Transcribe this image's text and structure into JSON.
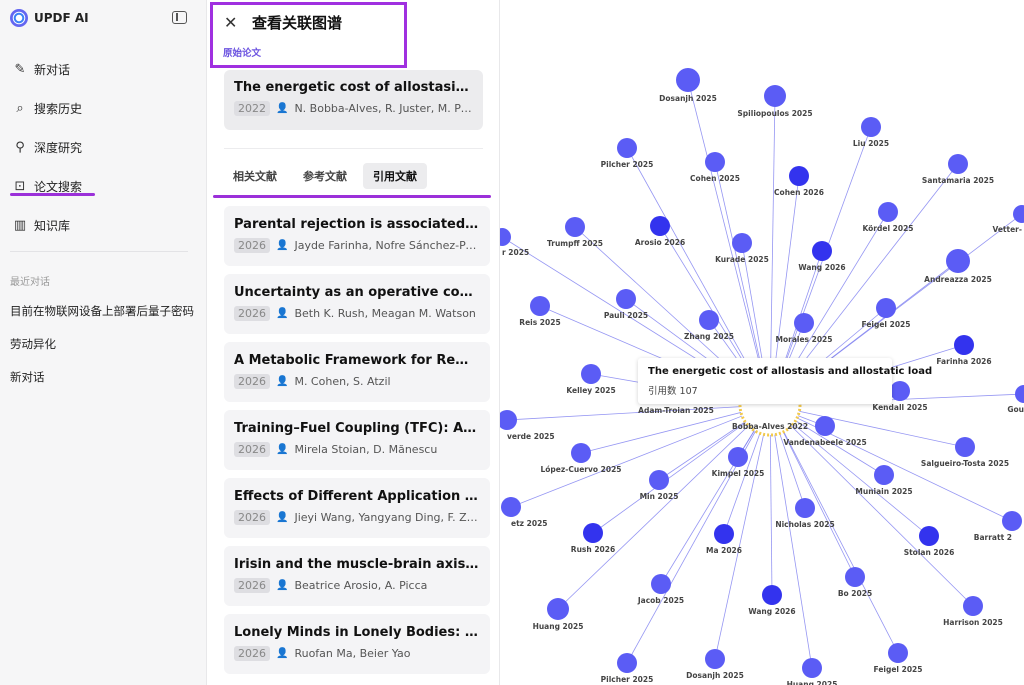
{
  "sidebar": {
    "brand": "UPDF AI",
    "nav": [
      {
        "label": "新对话",
        "icon": "edit-icon"
      },
      {
        "label": "搜索历史",
        "icon": "search-icon"
      },
      {
        "label": "深度研究",
        "icon": "telescope-icon"
      },
      {
        "label": "论文搜索",
        "icon": "paper-search-icon"
      },
      {
        "label": "知识库",
        "icon": "book-icon"
      }
    ],
    "recent_title": "最近对话",
    "recent": [
      "目前在物联网设备上部署后量子密码",
      "劳动异化",
      "新对话"
    ]
  },
  "panel": {
    "title": "查看关联图谱",
    "source_label": "原始论文",
    "source_paper": {
      "title": "The energetic cost of allostasis and allostatic load",
      "year": "2022",
      "authors": "N. Bobba-Alves, R. Juster, M. Picard"
    },
    "tabs": [
      "相关文献",
      "参考文献",
      "引用文献"
    ],
    "active_tab": "引用文献",
    "papers": [
      {
        "title": "Parental rejection is associated with",
        "year": "2026",
        "authors": "Jayde Farinha, Nofre Sánchez-Perea"
      },
      {
        "title": "Uncertainty as an operative construct",
        "year": "2026",
        "authors": "Beth K. Rush, Meagan M. Watson"
      },
      {
        "title": "A Metabolic Framework for Reward",
        "year": "2026",
        "authors": "M. Cohen, S. Atzil"
      },
      {
        "title": "Training–Fuel Coupling (TFC): A Model",
        "year": "2026",
        "authors": "Mirela Stoian, D. Mănescu"
      },
      {
        "title": "Effects of Different Application Strategies",
        "year": "2026",
        "authors": "Jieyi Wang, Yangyang Ding, F. Zhang"
      },
      {
        "title": "Irisin and the muscle-brain axis: a review",
        "year": "2026",
        "authors": "Beatrice Arosio, A. Picca"
      },
      {
        "title": "Lonely Minds in Lonely Bodies: Loneliness",
        "year": "2026",
        "authors": "Ruofan Ma, Beier Yao"
      }
    ]
  },
  "graph": {
    "tooltip_title": "The energetic cost of allostasis and allostatic load",
    "tooltip_count": "引用数 107",
    "center_label": "Bobba-Alves 2022",
    "colors": {
      "node": "#5b5cf5",
      "node_dark": "#3333ee",
      "edge": "#7b7cf0",
      "center": "#f2c94c"
    },
    "nodes": [
      {
        "label": "Dosanjh 2025",
        "dark": false
      },
      {
        "label": "Spiliopoulos 2025",
        "dark": false
      },
      {
        "label": "Liu 2025",
        "dark": false
      },
      {
        "label": "Pilcher 2025",
        "dark": false
      },
      {
        "label": "Cohen 2025",
        "dark": false
      },
      {
        "label": "Cohen 2026",
        "dark": true
      },
      {
        "label": "Santamaria 2025",
        "dark": false
      },
      {
        "label": "Vetter-",
        "dark": false
      },
      {
        "label": "Trumpff 2025",
        "dark": false
      },
      {
        "label": "Arosio 2026",
        "dark": true
      },
      {
        "label": "Kurade 2025",
        "dark": false
      },
      {
        "label": "Kördel 2025",
        "dark": false
      },
      {
        "label": "r 2025",
        "dark": false
      },
      {
        "label": "Wang 2026",
        "dark": true
      },
      {
        "label": "Andreazza 2025",
        "dark": false
      },
      {
        "label": "Reis 2025",
        "dark": false
      },
      {
        "label": "Pauli 2025",
        "dark": false
      },
      {
        "label": "Zhang 2025",
        "dark": false
      },
      {
        "label": "Feigel 2025",
        "dark": false
      },
      {
        "label": "Morales 2025",
        "dark": false
      },
      {
        "label": "Farinha 2026",
        "dark": true
      },
      {
        "label": "Kelley 2025",
        "dark": false
      },
      {
        "label": "Kendall 2025",
        "dark": false
      },
      {
        "label": "Adam-Troian 2025",
        "dark": false
      },
      {
        "label": "Gou",
        "dark": false
      },
      {
        "label": "verde 2025",
        "dark": false
      },
      {
        "label": "Vandenabeele 2025",
        "dark": false
      },
      {
        "label": "Salgueiro-Tosta 2025",
        "dark": false
      },
      {
        "label": "López-Cuervo 2025",
        "dark": false
      },
      {
        "label": "Kimpel 2025",
        "dark": false
      },
      {
        "label": "Muniain 2025",
        "dark": false
      },
      {
        "label": "Min 2025",
        "dark": false
      },
      {
        "label": "etz 2025",
        "dark": false
      },
      {
        "label": "Nicholas 2025",
        "dark": false
      },
      {
        "label": "Barratt 2",
        "dark": false
      },
      {
        "label": "Rush 2026",
        "dark": true
      },
      {
        "label": "Ma 2026",
        "dark": true
      },
      {
        "label": "Stolan 2026",
        "dark": true
      },
      {
        "label": "Jacob 2025",
        "dark": false
      },
      {
        "label": "Bo 2025",
        "dark": false
      },
      {
        "label": "Wang 2026",
        "dark": true
      },
      {
        "label": "Huang 2025",
        "dark": false
      },
      {
        "label": "Harrison 2025",
        "dark": false
      },
      {
        "label": "Pilcher 2025",
        "dark": false
      },
      {
        "label": "Dosanjh 2025",
        "dark": false
      },
      {
        "label": "Feigel 2025",
        "dark": false
      },
      {
        "label": "Huang 2025",
        "dark": false
      }
    ]
  }
}
